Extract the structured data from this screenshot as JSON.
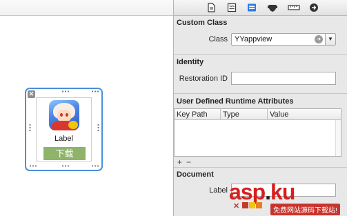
{
  "canvas": {
    "view": {
      "label": "Label",
      "button_text": "下载"
    }
  },
  "inspector": {
    "toolbar_icons": [
      "file-icon",
      "quick-help-icon",
      "identity-inspector-icon",
      "attributes-inspector-icon",
      "size-inspector-icon",
      "connections-inspector-icon"
    ],
    "custom_class": {
      "title": "Custom Class",
      "class_label": "Class",
      "class_value": "YYappview"
    },
    "identity": {
      "title": "Identity",
      "restoration_label": "Restoration ID",
      "restoration_value": ""
    },
    "runtime_attributes": {
      "title": "User Defined Runtime Attributes",
      "columns": [
        "Key Path",
        "Type",
        "Value"
      ],
      "add_symbol": "+",
      "remove_symbol": "−"
    },
    "document": {
      "title": "Document",
      "label_label": "Label",
      "label_value": ""
    }
  },
  "watermark": {
    "brand_asp": "asp",
    "brand_ku": "ku",
    "brand_dot": ".",
    "subtitle": "免费网站源码下载站!",
    "close_mark": "✕"
  }
}
